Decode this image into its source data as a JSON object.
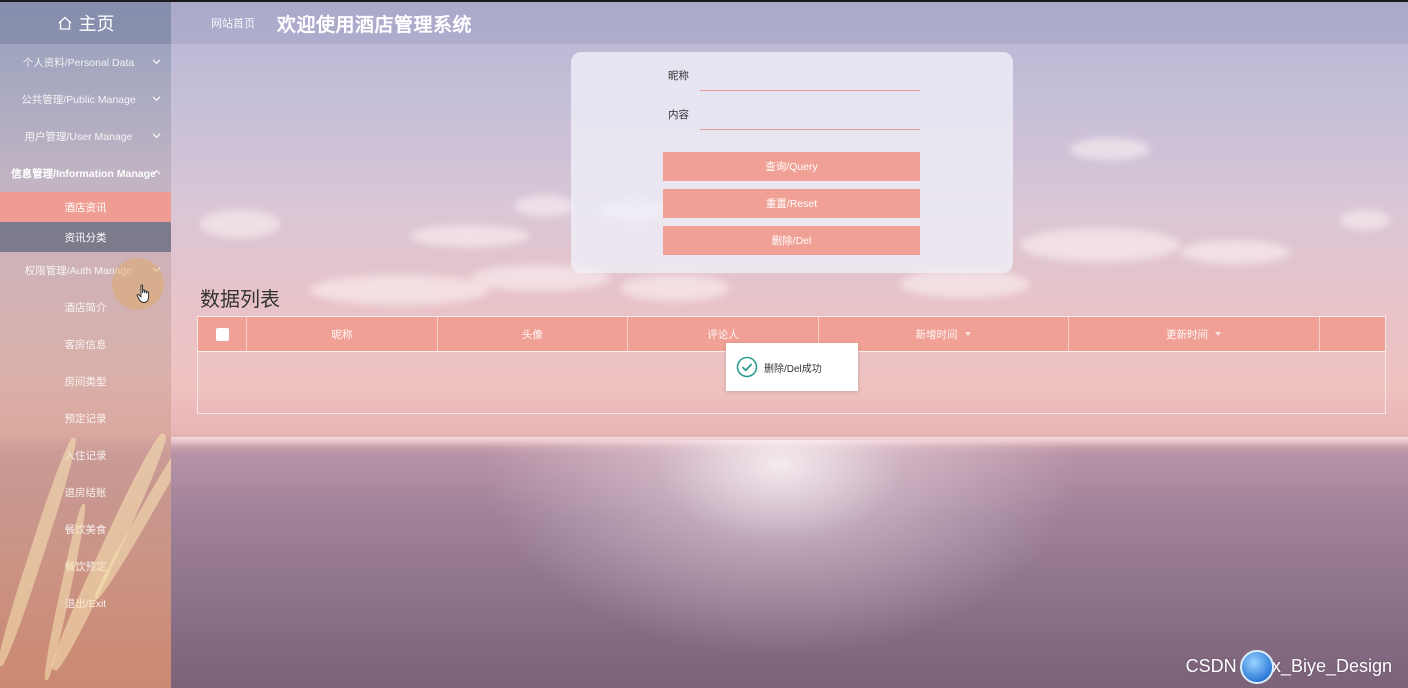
{
  "sidebar": {
    "home_label": "主页",
    "groups": [
      {
        "label": "个人资料/Personal Data",
        "open": false
      },
      {
        "label": "公共管理/Public Manage",
        "open": false
      },
      {
        "label": "用户管理/User Manage",
        "open": false
      },
      {
        "label": "信息管理/Information Manage",
        "open": true
      }
    ],
    "info_subitems": [
      {
        "label": "酒店资讯",
        "active": true
      },
      {
        "label": "资讯分类",
        "active": false
      }
    ],
    "auth_group": {
      "label": "权限管理/Auth Manage",
      "open": false
    },
    "items": [
      "酒店简介",
      "客房信息",
      "房间类型",
      "预定记录",
      "入住记录",
      "退房结账",
      "餐饮美食",
      "餐饮预定",
      "退出/Exit"
    ]
  },
  "header": {
    "breadcrumb": "网站首页",
    "title": "欢迎使用酒店管理系统"
  },
  "search": {
    "nickname_label": "昵称",
    "nickname_value": "",
    "content_label": "内容",
    "content_value": "",
    "query_button": "查询/Query",
    "reset_button": "重置/Reset",
    "delete_button": "删除/Del"
  },
  "list": {
    "title": "数据列表",
    "columns": [
      "昵称",
      "头像",
      "评论人",
      "新增时间",
      "更新时间",
      ""
    ],
    "rows": []
  },
  "toast": {
    "message": "删除/Del成功"
  },
  "watermark": {
    "text_left": "CSDN",
    "text_right": "@vx_Biye_Design"
  },
  "colors": {
    "accent": "#f0a095",
    "active_menu": "#ef9d93",
    "success": "#2a9d8f"
  }
}
